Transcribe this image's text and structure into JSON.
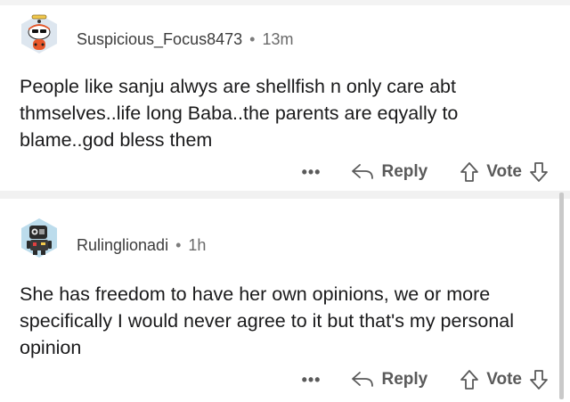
{
  "comments": [
    {
      "username": "Suspicious_Focus8473",
      "separator": "•",
      "time": "13m",
      "text": "People like sanju alwys are shellfish n only care abt thmselves..life long Baba..the parents are eqyally to blame..god bless them",
      "more_label": "•••",
      "reply_label": "Reply",
      "vote_label": "Vote"
    },
    {
      "username": "Rulinglionadi",
      "separator": "•",
      "time": "1h",
      "text": "She has freedom to have her own opinions, we or more specifically I would never agree to it but that's my personal opinion",
      "more_label": "•••",
      "reply_label": "Reply",
      "vote_label": "Vote"
    }
  ],
  "icons": {
    "avatar_1": "snoo-avatar-icon",
    "avatar_2": "robot-avatar-icon",
    "reply": "reply-arrow-icon",
    "upvote": "upvote-arrow-icon",
    "downvote": "downvote-arrow-icon"
  },
  "colors": {
    "text": "#1a1a1b",
    "meta": "#6a6a6a",
    "avatar_bg_1": "#d9e4ef",
    "avatar_bg_2": "#b8d9ea"
  }
}
